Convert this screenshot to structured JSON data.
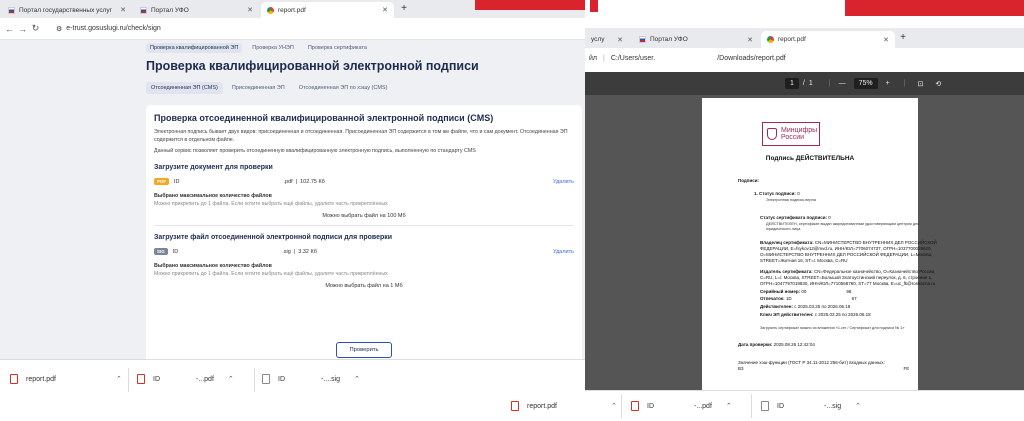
{
  "left": {
    "tabs": [
      {
        "label": "Портал государственных услуг"
      },
      {
        "label": "Портал УФО"
      },
      {
        "label": "report.pdf"
      }
    ],
    "url": "e-trust.gosuslugi.ru/check/sign",
    "top_tabs": [
      "Проверка квалифицированной ЭП",
      "Проверка УНЭП",
      "Проверка сертификата"
    ],
    "page_title": "Проверка квалифицированной электронной подписи",
    "sig_tabs": [
      "Отсоединенная ЭП (CMS)",
      "Присоединенная ЭП",
      "Отсоединенная ЭП по хэшу (CMS)"
    ],
    "card": {
      "heading": "Проверка отсоединенной квалифицированной электронной подписи (CMS)",
      "para1": "Электронная подпись бывает двух видов: присоединенная и отсоединенная. Присоединенная ЭП содержится в том же файле, что и сам документ. Отсоединенная ЭП содержится в отдельном файле.",
      "para2": "Данный сервис позволяет проверить отсоединенную квалифицированную электронную подпись, выполненную по стандарту CMS",
      "doc_section": "Загрузите документ для проверки",
      "doc_badge": "PDF",
      "doc_name_start": "ID",
      "doc_name_end": ".pdf",
      "doc_size": "102.75 Кб",
      "delete_label": "Удалить",
      "warn_bold": "Выбрано максимальное количество файлов",
      "warn_text": "Можно прикрепить до 1 файла. Если хотите выбрать ещё файлы, удалите часть прикреплённых",
      "doc_limit": "Можно выбрать файл на 100 Мб",
      "sig_section": "Загрузите файл отсоединенной электронной подписи для проверки",
      "sig_badge": "SIG",
      "sig_name_start": "ID",
      "sig_name_end": ".sig",
      "sig_size": "3.32 Кб",
      "sig_limit": "Можно выбрать файл на 1 Мб",
      "check_button": "Проверить"
    },
    "downloads": [
      {
        "name": "report.pdf"
      },
      {
        "name": "ID",
        "ext": "-...pdf"
      },
      {
        "name": "ID",
        "ext": "-....sig"
      }
    ]
  },
  "right": {
    "tabs": [
      {
        "label": "услу"
      },
      {
        "label": "Портал УФО"
      },
      {
        "label": "report.pdf"
      }
    ],
    "path_start": "C:/Users/user.",
    "path_end": "/Downloads/report.pdf",
    "page_current": "1",
    "page_total": "1",
    "zoom": "75%",
    "doc": {
      "logo_line1": "Минцифры",
      "logo_line2": "России",
      "title": "Подпись ДЕЙСТВИТЕЛЬНА",
      "signatures_label": "Подписи:",
      "status_label": "1. Статус подписи:",
      "status_value": "0",
      "status_note": "Электронная подпись верна",
      "cert_status_label": "Статус сертификата подписи:",
      "cert_status_value": "0",
      "cert_status_note1": "ДЕЙСТВИТЕЛЕН, сертификат выдан аккредитованным удостоверяющим центром для",
      "cert_status_note2": "юридического лица",
      "owner_label": "Владелец сертификата:",
      "owner_text1": "CN=МИНИСТЕРСТВО ВНУТРЕННИХ ДЕЛ РОССИЙСКОЙ",
      "owner_text2": "ФЕДЕРАЦИИ, E=fsykov12@mvd.ru, ИНН/ЮЛ=7706074737, ОГРН=1037700029620,",
      "owner_text3": "O=МИНИСТЕРСТВО ВНУТРЕННИХ ДЕЛ РОССИЙСКОЙ ФЕДЕРАЦИИ, L=Москва,",
      "owner_text4": "STREET=Житная 16, ST=г. Москва, C=RU",
      "issuer_label": "Издатель сертификата:",
      "issuer_text1": "CN=Федеральное казначейство, O=Казначейство России,",
      "issuer_text2": "C=RU, L=г. Москва, STREET=Большой Златоустинский переулок, д. 6, строение 1,",
      "issuer_text3": "ОГРН=1047797019830, ИНН/ЮЛ=7710568760, ST=77 Москва, E=uc_fk@roskazna.ru",
      "serial_label": "Серийный номер:",
      "serial_value_start": "00",
      "serial_value_end": "98",
      "stamp_label": "Отпечаток:",
      "stamp_value_start": "1D",
      "stamp_value_end": "67",
      "valid_label": "Действителен:",
      "valid_value": "с 2025.03.25 по 2026.06.18",
      "key_label": "Ключ ЭП действителен:",
      "key_value": "с 2025.03.25 по 2026.06.18",
      "download_note": "Загрузить сертификат можно из вложения «1.cer / Сертификат для подписи № 1»",
      "check_date_label": "Дата проверки:",
      "check_date_value": "2025.08.26 12:42:04",
      "hash_label": "Значение хэш-функции (ГОСТ Р 34.11-2012 256-бит) входных данных:",
      "hash_start": "B3",
      "hash_end": "FE"
    },
    "downloads": [
      {
        "name": "report.pdf"
      },
      {
        "name": "ID",
        "ext": "-...pdf"
      },
      {
        "name": "ID",
        "ext": "-...sig"
      }
    ]
  },
  "colors": {
    "accent": "#2d4fb3",
    "pdf_badge": "#f5a623",
    "red": "#d9232d"
  }
}
